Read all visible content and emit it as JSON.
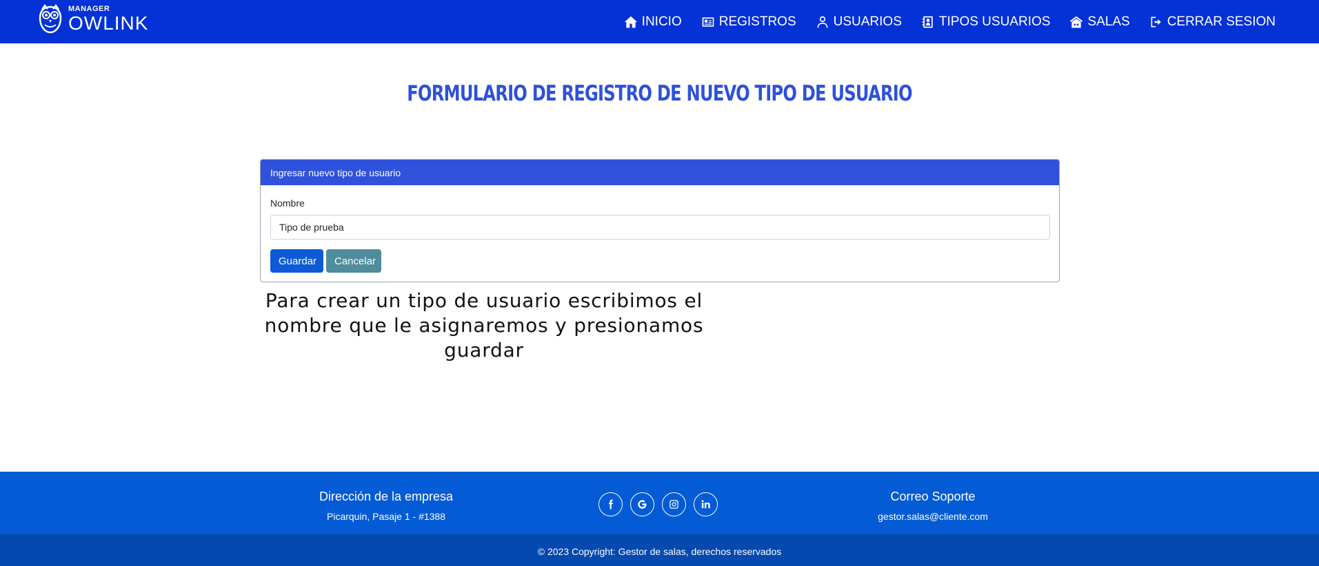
{
  "brand": {
    "small": "MANAGER",
    "name": "OWLINK"
  },
  "nav": {
    "items": [
      {
        "label": "INICIO",
        "icon": "home-icon"
      },
      {
        "label": "REGISTROS",
        "icon": "id-card-icon"
      },
      {
        "label": "USUARIOS",
        "icon": "user-icon"
      },
      {
        "label": "TIPOS USUARIOS",
        "icon": "contact-book-icon"
      },
      {
        "label": "SALAS",
        "icon": "building-icon"
      },
      {
        "label": "CERRAR SESION",
        "icon": "logout-icon"
      }
    ]
  },
  "page": {
    "title": "FORMULARIO DE REGISTRO DE NUEVO TIPO DE USUARIO"
  },
  "form": {
    "header": "Ingresar nuevo tipo de usuario",
    "name_label": "Nombre",
    "name_value": "Tipo de prueba",
    "save_label": "Guardar",
    "cancel_label": "Cancelar"
  },
  "caption": "Para crear un tipo de usuario escribimos el nombre que le asignaremos y presionamos guardar",
  "footer": {
    "address_title": "Dirección de la empresa",
    "address": "Picarquin, Pasaje 1 - #1388",
    "support_title": "Correo Soporte",
    "support_email": "gestor.salas@cliente.com",
    "socials": [
      "facebook-icon",
      "google-icon",
      "instagram-icon",
      "linkedin-icon"
    ],
    "copyright": "© 2023 Copyright: Gestor de salas, derechos reservados"
  },
  "colors": {
    "navbar": "#0432d6",
    "title": "#2e51da",
    "card_header": "#2f51db",
    "save": "#0d5ad6",
    "cancel": "#4f8c9c",
    "footer": "#045bd6",
    "copyright_bar": "#0349b0"
  }
}
